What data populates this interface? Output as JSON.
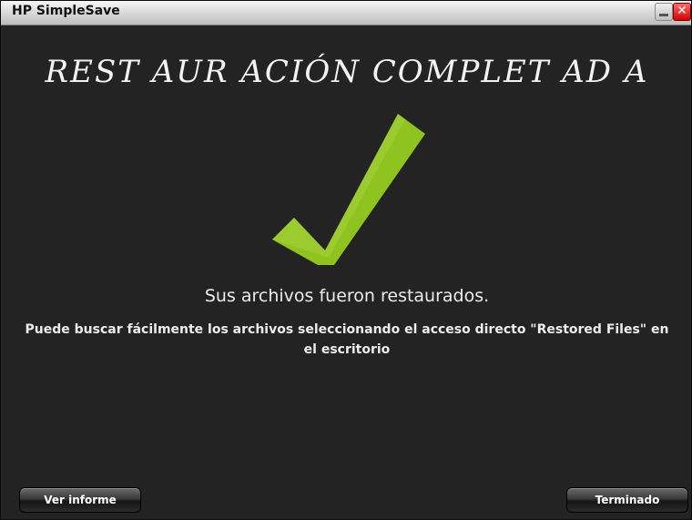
{
  "window": {
    "title": "HP SimpleSave",
    "minimize_icon": "minimize-icon",
    "close_icon": "close-icon",
    "close_glyph": "✕"
  },
  "main": {
    "heading": "REST AUR ACIÓN COMPLET AD A",
    "status_icon": "checkmark-icon",
    "accent_color": "#8fc31f",
    "message": "Sus archivos fueron restaurados.",
    "detail": "Puede buscar fácilmente los archivos seleccionando el acceso directo \"Restored Files\" en el escritorio"
  },
  "footer": {
    "report_button": "Ver informe",
    "done_button": "Terminado"
  }
}
